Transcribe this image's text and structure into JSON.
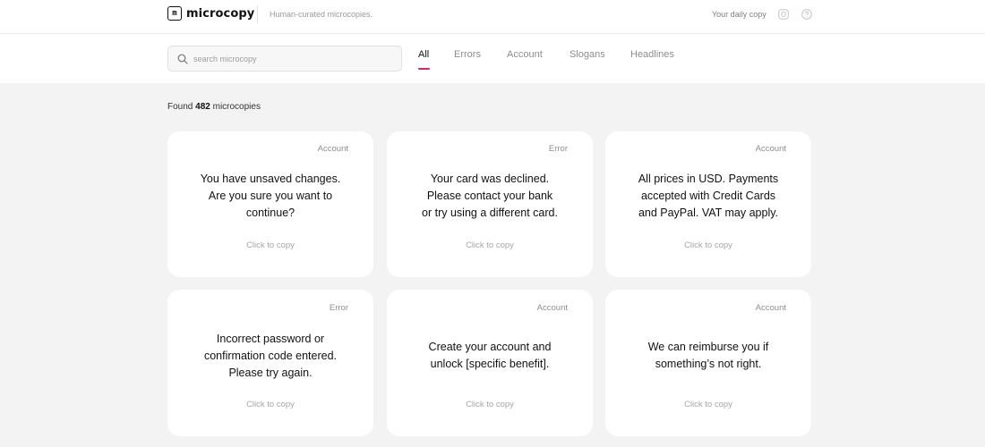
{
  "header": {
    "logo_glyph": "m",
    "logo_text": "microcopy",
    "tagline": "Human-curated microcopies.",
    "daily_copy": "Your daily copy",
    "icons": [
      "instagram-icon",
      "help-icon"
    ]
  },
  "search": {
    "placeholder": "search microcopy",
    "value": ""
  },
  "tabs": [
    {
      "label": "All",
      "active": true
    },
    {
      "label": "Errors",
      "active": false
    },
    {
      "label": "Account",
      "active": false
    },
    {
      "label": "Slogans",
      "active": false
    },
    {
      "label": "Headlines",
      "active": false
    }
  ],
  "found": {
    "prefix": "Found",
    "count": "482",
    "suffix": "microcopies"
  },
  "colors": {
    "accent": "#e0245e",
    "background": "#f3f3f3",
    "card": "#ffffff"
  },
  "cards": [
    {
      "category": "Account",
      "lines": [
        "You have unsaved changes.",
        "Are you sure you want to",
        "continue?"
      ],
      "action": "Click to copy"
    },
    {
      "category": "Error",
      "lines": [
        "Your card was declined.",
        "Please contact your bank",
        "or try using a different card."
      ],
      "action": "Click to copy"
    },
    {
      "category": "Account",
      "lines": [
        "All prices in USD. Payments",
        "accepted with Credit Cards",
        "and PayPal. VAT may apply."
      ],
      "action": "Click to copy"
    },
    {
      "category": "Error",
      "lines": [
        "Incorrect password or",
        "confirmation code entered.",
        "Please try again."
      ],
      "action": "Click to copy"
    },
    {
      "category": "Account",
      "lines": [
        "Create your account and",
        "unlock [specific benefit]."
      ],
      "action": "Click to copy"
    },
    {
      "category": "Account",
      "lines": [
        "We can reimburse you if",
        "something’s not right."
      ],
      "action": "Click to copy"
    }
  ]
}
